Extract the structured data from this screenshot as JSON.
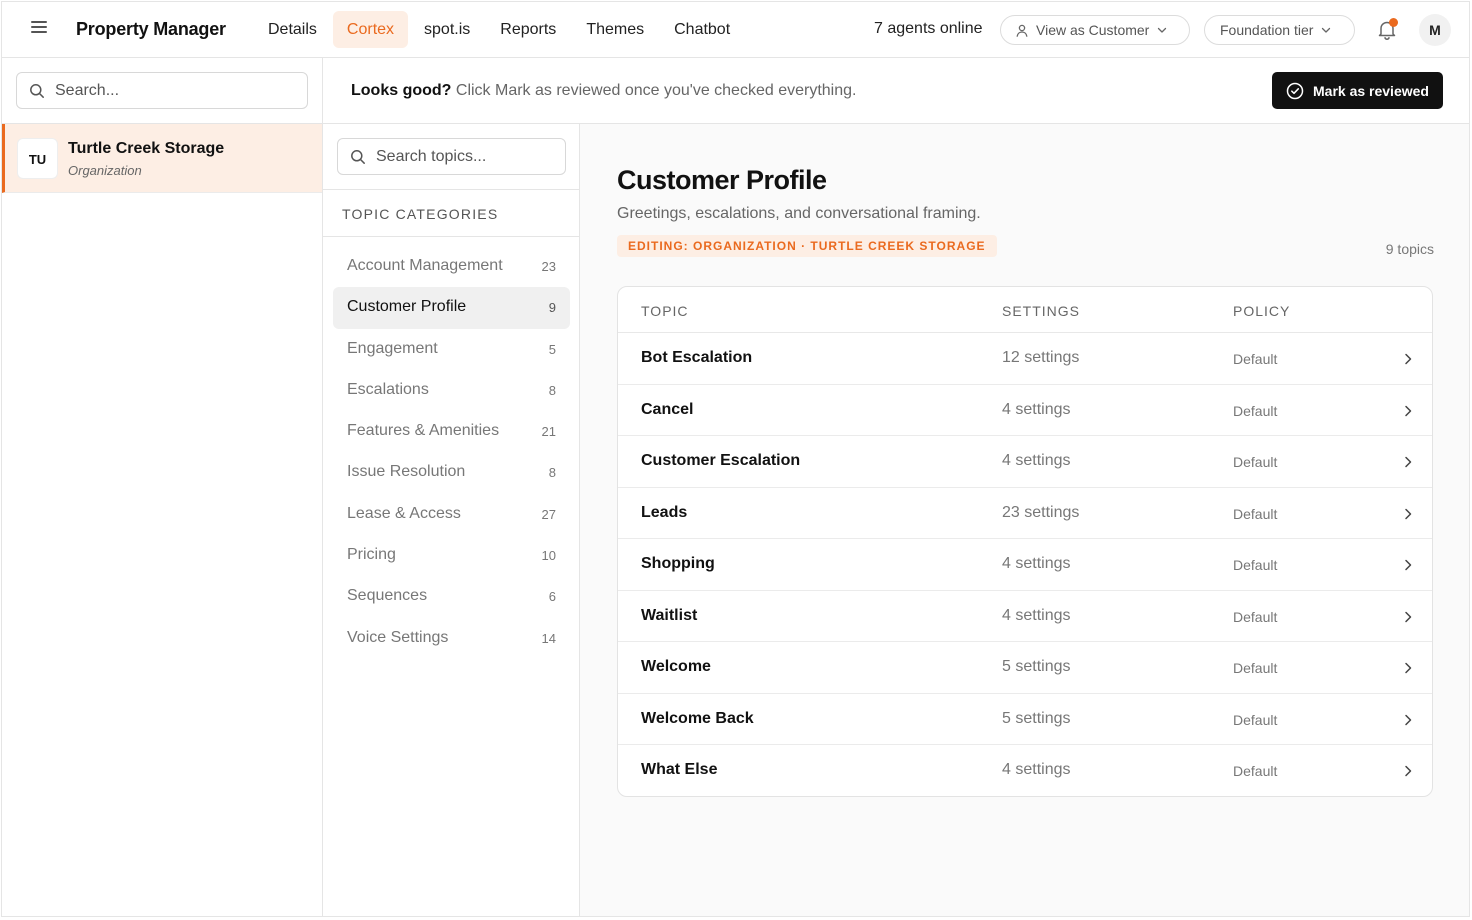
{
  "topnav": {
    "brand": "Property Manager",
    "tabs": [
      {
        "label": "Details",
        "active": false
      },
      {
        "label": "Cortex",
        "active": true
      },
      {
        "label": "spot.is",
        "active": false
      },
      {
        "label": "Reports",
        "active": false
      },
      {
        "label": "Themes",
        "active": false
      },
      {
        "label": "Chatbot",
        "active": false
      }
    ],
    "agents_online": "7 agents online",
    "view_as": "View as Customer",
    "tier": "Foundation tier",
    "avatar_initial": "M",
    "notification_dot": true
  },
  "sidebar": {
    "search_placeholder": "Search...",
    "org": {
      "initials": "TU",
      "name": "Turtle Creek Storage",
      "type": "Organization"
    }
  },
  "banner": {
    "lead": "Looks good?",
    "text": "Click Mark as reviewed once you've checked everything.",
    "button": "Mark as reviewed"
  },
  "categories": {
    "search_placeholder": "Search topics...",
    "heading": "TOPIC CATEGORIES",
    "items": [
      {
        "name": "Account Management",
        "count": "23"
      },
      {
        "name": "Customer Profile",
        "count": "9",
        "active": true
      },
      {
        "name": "Engagement",
        "count": "5"
      },
      {
        "name": "Escalations",
        "count": "8"
      },
      {
        "name": "Features & Amenities",
        "count": "21"
      },
      {
        "name": "Issue Resolution",
        "count": "8"
      },
      {
        "name": "Lease & Access",
        "count": "27"
      },
      {
        "name": "Pricing",
        "count": "10"
      },
      {
        "name": "Sequences",
        "count": "6"
      },
      {
        "name": "Voice Settings",
        "count": "14"
      }
    ]
  },
  "main": {
    "title": "Customer Profile",
    "subtitle": "Greetings, escalations, and conversational framing.",
    "editing_badge": "EDITING: ORGANIZATION · TURTLE CREEK STORAGE",
    "topic_count": "9 topics",
    "table": {
      "headers": {
        "topic": "TOPIC",
        "settings": "SETTINGS",
        "policy": "POLICY"
      },
      "rows": [
        {
          "topic": "Bot Escalation",
          "settings": "12 settings",
          "policy": "Default"
        },
        {
          "topic": "Cancel",
          "settings": "4 settings",
          "policy": "Default"
        },
        {
          "topic": "Customer Escalation",
          "settings": "4 settings",
          "policy": "Default"
        },
        {
          "topic": "Leads",
          "settings": "23 settings",
          "policy": "Default"
        },
        {
          "topic": "Shopping",
          "settings": "4 settings",
          "policy": "Default"
        },
        {
          "topic": "Waitlist",
          "settings": "4 settings",
          "policy": "Default"
        },
        {
          "topic": "Welcome",
          "settings": "5 settings",
          "policy": "Default"
        },
        {
          "topic": "Welcome Back",
          "settings": "5 settings",
          "policy": "Default"
        },
        {
          "topic": "What Else",
          "settings": "4 settings",
          "policy": "Default"
        }
      ]
    }
  },
  "colors": {
    "accent": "#ea6a1f",
    "accent_bg": "#fdeee4",
    "primary_button": "#111111"
  },
  "icons": [
    "menu-icon",
    "search-icon",
    "user-icon",
    "chevron-down-icon",
    "bell-icon",
    "check-circle-icon",
    "chevron-right-icon"
  ]
}
